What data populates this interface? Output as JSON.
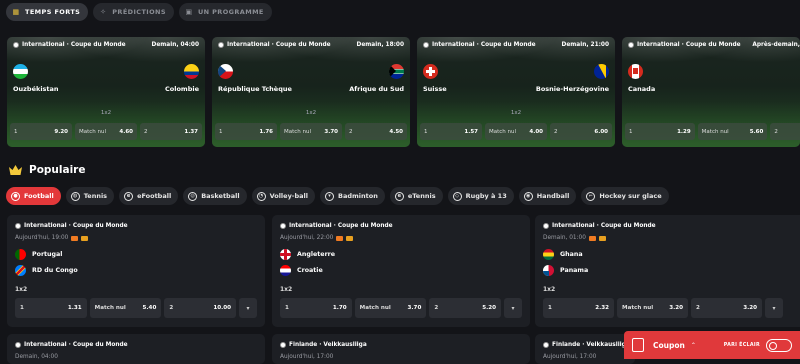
{
  "topnav": [
    {
      "label": "TEMPS FORTS",
      "icon": "grid-icon",
      "active": true
    },
    {
      "label": "PRÉDICTIONS",
      "icon": "sparkle-icon",
      "active": false
    },
    {
      "label": "UN PROGRAMME",
      "icon": "calendar-icon",
      "active": false
    }
  ],
  "highlights": [
    {
      "competition": "International · Coupe du Monde",
      "time": "Demain, 04:00",
      "team1": "Ouzbékistan",
      "team2": "Colombie",
      "market": "1x2",
      "odds": [
        {
          "label": "1",
          "value": "9.20"
        },
        {
          "label": "Match nul",
          "value": "4.60"
        },
        {
          "label": "2",
          "value": "1.37"
        }
      ]
    },
    {
      "competition": "International · Coupe du Monde",
      "time": "Demain, 18:00",
      "team1": "République Tchèque",
      "team2": "Afrique du Sud",
      "market": "1x2",
      "odds": [
        {
          "label": "1",
          "value": "1.76"
        },
        {
          "label": "Match nul",
          "value": "3.70"
        },
        {
          "label": "2",
          "value": "4.50"
        }
      ]
    },
    {
      "competition": "International · Coupe du Monde",
      "time": "Demain, 21:00",
      "team1": "Suisse",
      "team2": "Bosnie-Herzégovine",
      "market": "1x2",
      "odds": [
        {
          "label": "1",
          "value": "1.57"
        },
        {
          "label": "Match nul",
          "value": "4.00"
        },
        {
          "label": "2",
          "value": "6.00"
        }
      ]
    },
    {
      "competition": "International · Coupe du Monde",
      "time": "Après-demain,",
      "team1": "Canada",
      "team2": "",
      "market": "",
      "odds": [
        {
          "label": "1",
          "value": "1.29"
        },
        {
          "label": "Match nul",
          "value": "5.60"
        },
        {
          "label": "2",
          "value": ""
        }
      ]
    }
  ],
  "section": {
    "title": "Populaire"
  },
  "sports": [
    {
      "label": "Football",
      "active": true
    },
    {
      "label": "Tennis",
      "active": false
    },
    {
      "label": "eFootball",
      "active": false
    },
    {
      "label": "Basketball",
      "active": false
    },
    {
      "label": "Volley-ball",
      "active": false
    },
    {
      "label": "Badminton",
      "active": false
    },
    {
      "label": "eTennis",
      "active": false
    },
    {
      "label": "Rugby à 13",
      "active": false
    },
    {
      "label": "Handball",
      "active": false
    },
    {
      "label": "Hockey sur glace",
      "active": false
    }
  ],
  "matches": [
    {
      "competition": "International · Coupe du Monde",
      "time": "Aujourd'hui, 19:00",
      "team1": "Portugal",
      "team2": "RD du Congo",
      "market": "1x2",
      "odds": [
        {
          "label": "1",
          "value": "1.31"
        },
        {
          "label": "Match nul",
          "value": "5.40"
        },
        {
          "label": "2",
          "value": "10.00"
        }
      ]
    },
    {
      "competition": "International · Coupe du Monde",
      "time": "Aujourd'hui, 22:00",
      "team1": "Angleterre",
      "team2": "Croatie",
      "market": "1x2",
      "odds": [
        {
          "label": "1",
          "value": "1.70"
        },
        {
          "label": "Match nul",
          "value": "3.70"
        },
        {
          "label": "2",
          "value": "5.20"
        }
      ]
    },
    {
      "competition": "International · Coupe du Monde",
      "time": "Demain, 01:00",
      "team1": "Ghana",
      "team2": "Panama",
      "market": "1x2",
      "odds": [
        {
          "label": "1",
          "value": "2.32"
        },
        {
          "label": "Match nul",
          "value": "3.20"
        },
        {
          "label": "2",
          "value": "3.20"
        }
      ]
    }
  ],
  "next_matches": [
    {
      "competition": "International · Coupe du Monde",
      "time": "Demain, 04:00"
    },
    {
      "competition": "Finlande · Veikkausliiga",
      "time": "Aujourd'hui, 17:00"
    },
    {
      "competition": "Finlande · Veikkausliiga",
      "time": "Aujourd'hui, 17:00"
    }
  ],
  "coupon": {
    "label": "Coupon",
    "fullscreen": "PARI ÉCLAIR"
  },
  "colors": {
    "accent": "#e3383a",
    "gold": "#f3c93c",
    "bg": "#131418",
    "card": "#1d1f24"
  }
}
